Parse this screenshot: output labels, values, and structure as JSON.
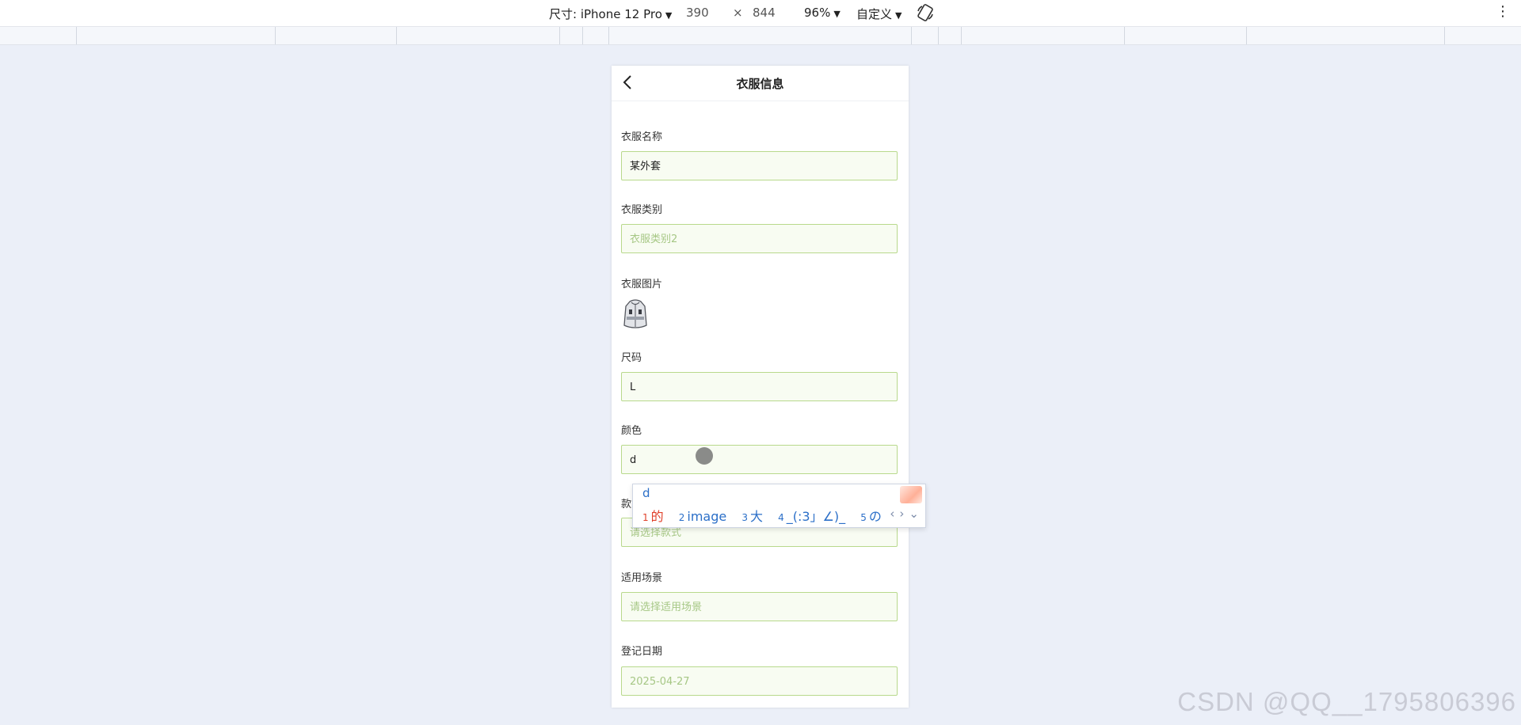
{
  "devtools": {
    "device_label": "尺寸: iPhone 12 Pro",
    "width": "390",
    "times": "×",
    "height": "844",
    "zoom": "96%",
    "custom": "自定义",
    "more": "⋮"
  },
  "app": {
    "title": "衣服信息",
    "fields": {
      "name": {
        "label": "衣服名称",
        "value": "某外套"
      },
      "category": {
        "label": "衣服类别",
        "placeholder": "衣服类别2"
      },
      "image": {
        "label": "衣服图片"
      },
      "size": {
        "label": "尺码",
        "value": "L"
      },
      "color": {
        "label": "颜色",
        "value": "d"
      },
      "style": {
        "label": "款式",
        "placeholder": "请选择款式"
      },
      "scene": {
        "label": "适用场景",
        "placeholder": "请选择适用场景"
      },
      "date": {
        "label": "登记日期",
        "value": "2025-04-27"
      }
    }
  },
  "ime": {
    "composition": "d",
    "candidates": [
      {
        "num": "1",
        "text": "的"
      },
      {
        "num": "2",
        "text": "image"
      },
      {
        "num": "3",
        "text": "大"
      },
      {
        "num": "4",
        "text": "_(:3」∠)_"
      },
      {
        "num": "5",
        "text": "の"
      }
    ],
    "prev": "‹",
    "next": "›",
    "expand": "⌄"
  },
  "watermark": "CSDN @QQ__1795806396",
  "colors": {
    "input_border": "#b8d98c",
    "input_bg": "#f8fcf2",
    "placeholder": "#a6c785",
    "ime_accent": "#2b6fc8",
    "ime_first": "#e0402a"
  }
}
